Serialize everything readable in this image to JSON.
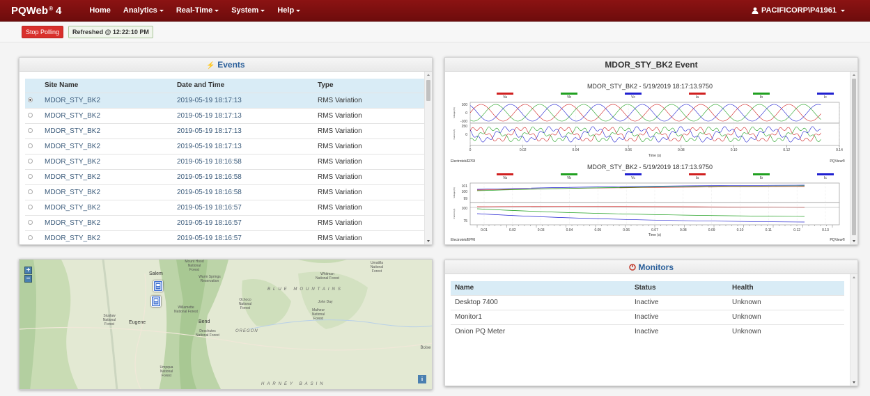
{
  "nav": {
    "brand": "PQWeb",
    "brand_reg": "®",
    "brand_version": "4",
    "items": [
      {
        "label": "Home",
        "dropdown": false
      },
      {
        "label": "Analytics",
        "dropdown": true
      },
      {
        "label": "Real-Time",
        "dropdown": true
      },
      {
        "label": "System",
        "dropdown": true
      },
      {
        "label": "Help",
        "dropdown": true
      }
    ],
    "user": "PACIFICORP\\P41961",
    "color": "#7e1010"
  },
  "toolbar": {
    "stop_label": "Stop Polling",
    "refreshed_label": "Refreshed @ 12:22:10 PM"
  },
  "events": {
    "title": "Events",
    "icon": "lightning-icon",
    "columns": [
      "Site Name",
      "Date and Time",
      "Type"
    ],
    "rows": [
      {
        "site": "MDOR_STY_BK2",
        "time": "2019-05-19 18:17:13",
        "type": "RMS Variation",
        "selected": true
      },
      {
        "site": "MDOR_STY_BK2",
        "time": "2019-05-19 18:17:13",
        "type": "RMS Variation",
        "selected": false
      },
      {
        "site": "MDOR_STY_BK2",
        "time": "2019-05-19 18:17:13",
        "type": "RMS Variation",
        "selected": false
      },
      {
        "site": "MDOR_STY_BK2",
        "time": "2019-05-19 18:17:13",
        "type": "RMS Variation",
        "selected": false
      },
      {
        "site": "MDOR_STY_BK2",
        "time": "2019-05-19 18:16:58",
        "type": "RMS Variation",
        "selected": false
      },
      {
        "site": "MDOR_STY_BK2",
        "time": "2019-05-19 18:16:58",
        "type": "RMS Variation",
        "selected": false
      },
      {
        "site": "MDOR_STY_BK2",
        "time": "2019-05-19 18:16:58",
        "type": "RMS Variation",
        "selected": false
      },
      {
        "site": "MDOR_STY_BK2",
        "time": "2019-05-19 18:16:57",
        "type": "RMS Variation",
        "selected": false
      },
      {
        "site": "MDOR_STY_BK2",
        "time": "2019-05-19 18:16:57",
        "type": "RMS Variation",
        "selected": false
      },
      {
        "site": "MDOR_STY_BK2",
        "time": "2019-05-19 18:16:57",
        "type": "RMS Variation",
        "selected": false
      }
    ]
  },
  "event_chart": {
    "panel_title": "MDOR_STY_BK2 Event",
    "chart1_title": "MDOR_STY_BK2 - 5/19/2019 18:17:13.9750",
    "chart2_title": "MDOR_STY_BK2 - 5/19/2019 18:17:13.9750",
    "legend": [
      {
        "name": "Va",
        "color": "#d02020"
      },
      {
        "name": "Vb",
        "color": "#20a020"
      },
      {
        "name": "Vc",
        "color": "#2020d0"
      },
      {
        "name": "Ia",
        "color": "#d02020"
      },
      {
        "name": "Ib",
        "color": "#20a020"
      },
      {
        "name": "Ic",
        "color": "#2020d0"
      }
    ],
    "footer_left": "Electrotek/EPRI",
    "footer_right": "PQView®",
    "xlabel": "Time (s)",
    "ylabel_top": "Voltage (%)",
    "ylabel_bottom": "Current (A)",
    "chart1_xticks": [
      "0",
      "0.02",
      "0.04",
      "0.06",
      "0.08",
      "0.10",
      "0.12",
      "0.14"
    ],
    "chart1_v_ticks": [
      "100",
      "0",
      "-100"
    ],
    "chart1_i_ticks": [
      "250",
      "0"
    ],
    "chart2_xticks": [
      "0.01",
      "0.02",
      "0.03",
      "0.04",
      "0.05",
      "0.06",
      "0.07",
      "0.08",
      "0.09",
      "0.10",
      "0.11",
      "0.12",
      "0.13"
    ],
    "chart2_v_ticks": [
      "101",
      "100",
      "99"
    ],
    "chart2_i_ticks": [
      "100",
      "75"
    ]
  },
  "map": {
    "zoom_in": "+",
    "zoom_out": "−",
    "info": "i",
    "cities": [
      "Salem",
      "Eugene",
      "Bend"
    ],
    "regions": [
      "BLUE MOUNTAINS",
      "OREGON",
      "HARNEY BASIN"
    ],
    "forests": [
      "Siuslaw National Forest",
      "Willamette National Forest",
      "Deschutes National Forest",
      "Umpqua National Forest",
      "Ochoco National Forest",
      "Malheur National Forest",
      "Umatilla National Forest",
      "Whitman National Forest",
      "Mount Hood National Forest",
      "Warm Springs Reservation",
      "John Day",
      "Boise"
    ]
  },
  "monitors": {
    "title": "Monitors",
    "icon": "circle-power-icon",
    "columns": [
      "Name",
      "Status",
      "Health"
    ],
    "rows": [
      {
        "name": "Desktop 7400",
        "status": "Inactive",
        "health": "Unknown"
      },
      {
        "name": "Monitor1",
        "status": "Inactive",
        "health": "Unknown"
      },
      {
        "name": "Onion PQ Meter",
        "status": "Inactive",
        "health": "Unknown"
      }
    ]
  }
}
